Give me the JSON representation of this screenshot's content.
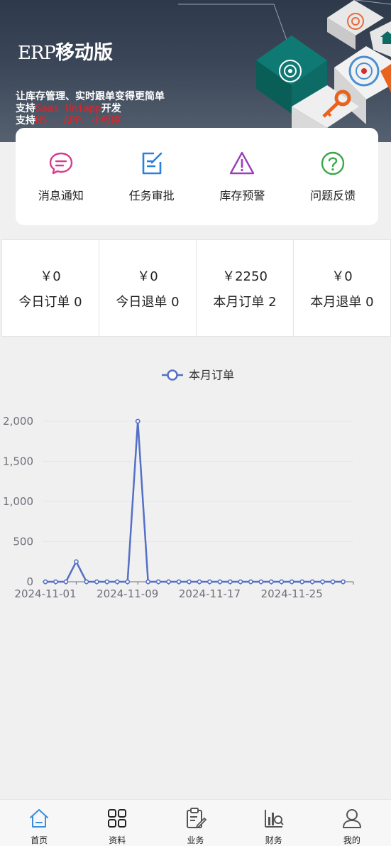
{
  "banner": {
    "title_en": "ERP",
    "title_cn": "移动版",
    "line1": "让库存管理、实时跟单变得更简单",
    "line2_prefix": "支持",
    "line2_red": "Saas   Uniapp",
    "line2_suffix": "开发",
    "line3_prefix": "支持",
    "line3_red": "H5 、APP、小程序"
  },
  "quick_actions": [
    {
      "label": "消息通知",
      "icon": "message-icon",
      "color": "#d63c8f"
    },
    {
      "label": "任务审批",
      "icon": "edit-icon",
      "color": "#2a80e0"
    },
    {
      "label": "库存预警",
      "icon": "warning-icon",
      "color": "#9b3fb8"
    },
    {
      "label": "问题反馈",
      "icon": "question-icon",
      "color": "#3aa84a"
    }
  ],
  "stats": [
    {
      "amount": "￥0",
      "label": "今日订单 0"
    },
    {
      "amount": "￥0",
      "label": "今日退单 0"
    },
    {
      "amount": "￥2250",
      "label": "本月订单 2"
    },
    {
      "amount": "￥0",
      "label": "本月退单 0"
    }
  ],
  "chart_data": {
    "type": "line",
    "legend": [
      "本月订单"
    ],
    "legend_position": "top-center",
    "x": [
      "2024-11-01",
      "2024-11-02",
      "2024-11-03",
      "2024-11-04",
      "2024-11-05",
      "2024-11-06",
      "2024-11-07",
      "2024-11-08",
      "2024-11-09",
      "2024-11-10",
      "2024-11-11",
      "2024-11-12",
      "2024-11-13",
      "2024-11-14",
      "2024-11-15",
      "2024-11-16",
      "2024-11-17",
      "2024-11-18",
      "2024-11-19",
      "2024-11-20",
      "2024-11-21",
      "2024-11-22",
      "2024-11-23",
      "2024-11-24",
      "2024-11-25",
      "2024-11-26",
      "2024-11-27",
      "2024-11-28",
      "2024-11-29",
      "2024-11-30"
    ],
    "x_tick_labels": [
      "2024-11-01",
      "2024-11-09",
      "2024-11-17",
      "2024-11-25"
    ],
    "series": [
      {
        "name": "本月订单",
        "values": [
          0,
          0,
          0,
          250,
          0,
          0,
          0,
          0,
          0,
          2000,
          0,
          0,
          0,
          0,
          0,
          0,
          0,
          0,
          0,
          0,
          0,
          0,
          0,
          0,
          0,
          0,
          0,
          0,
          0,
          0
        ]
      }
    ],
    "y_ticks": [
      0,
      500,
      1000,
      1500,
      2000
    ],
    "y_tick_labels": [
      "0",
      "500",
      "1,000",
      "1,500",
      "2,000"
    ],
    "ylim": [
      0,
      2000
    ],
    "grid": true,
    "color": "#5470c6"
  },
  "tabs": [
    {
      "label": "首页",
      "icon": "home-icon",
      "active": true
    },
    {
      "label": "资料",
      "icon": "grid-icon",
      "active": false
    },
    {
      "label": "业务",
      "icon": "clipboard-icon",
      "active": false
    },
    {
      "label": "财务",
      "icon": "finance-chart-icon",
      "active": false
    },
    {
      "label": "我的",
      "icon": "user-icon",
      "active": false
    }
  ]
}
